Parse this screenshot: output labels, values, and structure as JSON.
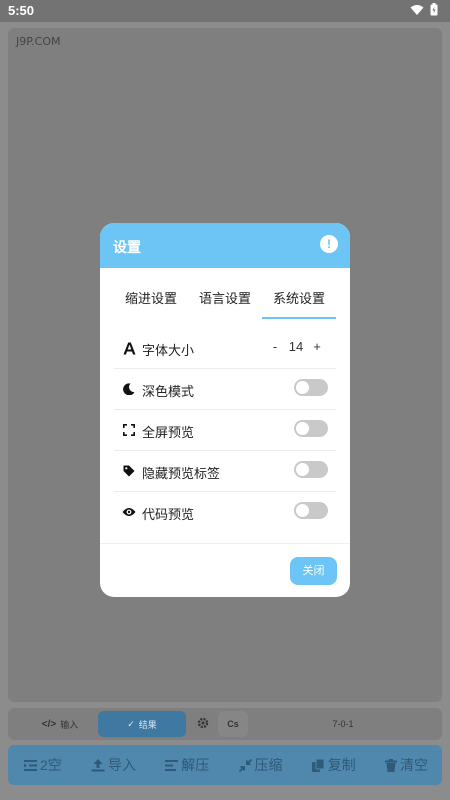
{
  "status_bar": {
    "time": "5:50"
  },
  "app": {
    "watermark": "J9P.COM",
    "controls": {
      "input_label": "输入",
      "input_glyph": "</>",
      "result_label": "结果",
      "cs_label": "Cs",
      "version": "7-0-1"
    },
    "toolbar": [
      {
        "label": "2空",
        "icon": "indent-icon"
      },
      {
        "label": "导入",
        "icon": "upload-icon"
      },
      {
        "label": "解压",
        "icon": "align-left-icon"
      },
      {
        "label": "压缩",
        "icon": "compress-icon"
      },
      {
        "label": "复制",
        "icon": "copy-icon"
      },
      {
        "label": "清空",
        "icon": "trash-icon"
      }
    ]
  },
  "dialog": {
    "title": "设置",
    "info_glyph": "!",
    "tabs": [
      {
        "label": "缩进设置",
        "active": false
      },
      {
        "label": "语言设置",
        "active": false
      },
      {
        "label": "系统设置",
        "active": true
      }
    ],
    "settings": {
      "font_size": {
        "label": "字体大小",
        "minus": "-",
        "value": "14",
        "plus": "+"
      },
      "dark_mode": {
        "label": "深色模式",
        "enabled": false
      },
      "fullscreen_preview": {
        "label": "全屏预览",
        "enabled": false
      },
      "hide_preview_tags": {
        "label": "隐藏预览标签",
        "enabled": false
      },
      "code_preview": {
        "label": "代码预览",
        "enabled": false
      }
    },
    "close_label": "关闭"
  },
  "colors": {
    "accent": "#6cc5f5",
    "overlay_bg": "#8c8c8c",
    "toggle_off": "#c9c9c9"
  }
}
